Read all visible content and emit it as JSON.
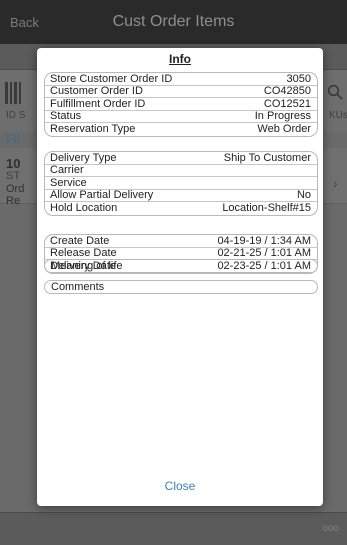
{
  "background": {
    "back_label": "Back",
    "title": "Cust Order Items",
    "id_label": "ID S",
    "filter_label": "Fil",
    "skus_label": "KUs",
    "item": {
      "num": "10",
      "st": "ST",
      "line3": "Ord",
      "line4": "Re"
    },
    "more_label": "ooo"
  },
  "dialog": {
    "title": "Info",
    "group1": [
      {
        "label": "Store Customer Order ID",
        "value": "3050"
      },
      {
        "label": "Customer Order ID",
        "value": "CO42850"
      },
      {
        "label": "Fulfillment Order ID",
        "value": "CO12521"
      },
      {
        "label": "Status",
        "value": "In Progress"
      },
      {
        "label": "Reservation Type",
        "value": "Web Order"
      }
    ],
    "group2": [
      {
        "label": "Delivery Type",
        "value": "Ship To Customer"
      },
      {
        "label": "Carrier",
        "value": ""
      },
      {
        "label": "Service",
        "value": ""
      },
      {
        "label": "Allow Partial Delivery",
        "value": "No"
      },
      {
        "label": "Hold Location",
        "value": "Location-Shelf#15"
      }
    ],
    "group3": [
      {
        "label": "Create Date",
        "value": "04-19-19 / 1:34 AM"
      },
      {
        "label": "Release Date",
        "value": "02-21-25 / 1:01 AM"
      },
      {
        "label": "Delivery Date",
        "value": "02-23-25 / 1:01 AM"
      }
    ],
    "meaning_label": "Meaning of life",
    "comments_label": "Comments",
    "close_label": "Close"
  }
}
